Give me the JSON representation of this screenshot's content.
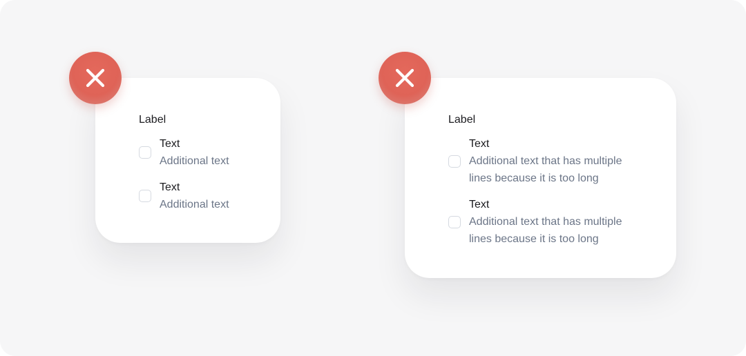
{
  "examples": [
    {
      "status_icon": "close-icon",
      "status_color": "#e0665a",
      "group_label": "Label",
      "options": [
        {
          "title": "Text",
          "description": "Additional text",
          "checked": false
        },
        {
          "title": "Text",
          "description": "Additional text",
          "checked": false
        }
      ]
    },
    {
      "status_icon": "close-icon",
      "status_color": "#e0665a",
      "group_label": "Label",
      "options": [
        {
          "title": "Text",
          "description_lines": [
            "Additional text that has multiple",
            "lines because it is too long"
          ],
          "checked": false
        },
        {
          "title": "Text",
          "description_lines": [
            "Additional text that has multiple",
            "lines because it is too long"
          ],
          "checked": false
        }
      ]
    }
  ]
}
